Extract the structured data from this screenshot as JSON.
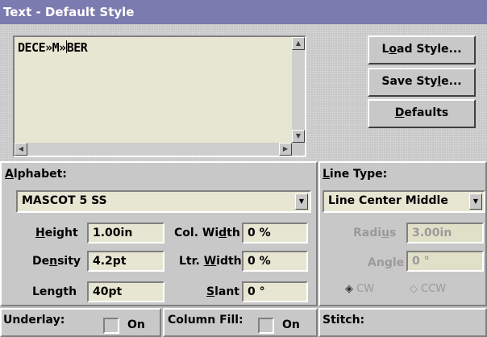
{
  "window": {
    "title": "Text - Default Style"
  },
  "text_entry": {
    "before_caret": "DECE»M»",
    "after_caret": "BER"
  },
  "buttons": {
    "load_style": {
      "pre": "L",
      "u": "o",
      "post": "ad Style..."
    },
    "save_style": {
      "pre": "Save Sty",
      "u": "l",
      "post": "e..."
    },
    "defaults": {
      "pre": "",
      "u": "D",
      "post": "efaults"
    }
  },
  "alphabet": {
    "label": {
      "pre": "",
      "u": "A",
      "post": "lphabet:"
    },
    "font": "MASCOT 5 SS",
    "height": {
      "pre": "",
      "u": "H",
      "post": "eight",
      "value": "1.00in"
    },
    "density": {
      "pre": "De",
      "u": "n",
      "post": "sity",
      "value": "4.2pt"
    },
    "length": {
      "text": "Length",
      "value": "40pt"
    },
    "col_width": {
      "pre": "Col. Wi",
      "u": "d",
      "post": "th",
      "value": "0 %"
    },
    "ltr_width": {
      "pre": "Ltr. ",
      "u": "W",
      "post": "idth",
      "value": "0 %"
    },
    "slant": {
      "pre": "",
      "u": "S",
      "post": "lant",
      "value": "0 °"
    }
  },
  "line_type": {
    "label": {
      "pre": "",
      "u": "L",
      "post": "ine Type:"
    },
    "value": "Line Center Middle",
    "radius": {
      "pre": "Radi",
      "u": "u",
      "post": "s",
      "value": "3.00in"
    },
    "angle": {
      "pre": "An",
      "u": "g",
      "post": "le",
      "value": "0 °"
    },
    "cw": "CW",
    "ccw": "CCW"
  },
  "underlay": {
    "label": "Underlay:",
    "on": "On"
  },
  "column_fill": {
    "label": "Column Fill:",
    "on": "On"
  },
  "stitch": {
    "label": "Stitch:"
  },
  "colors": {
    "title_bg": "#7b7bb0",
    "field_bg": "#e6e6d2",
    "face": "#c8c8c8"
  }
}
